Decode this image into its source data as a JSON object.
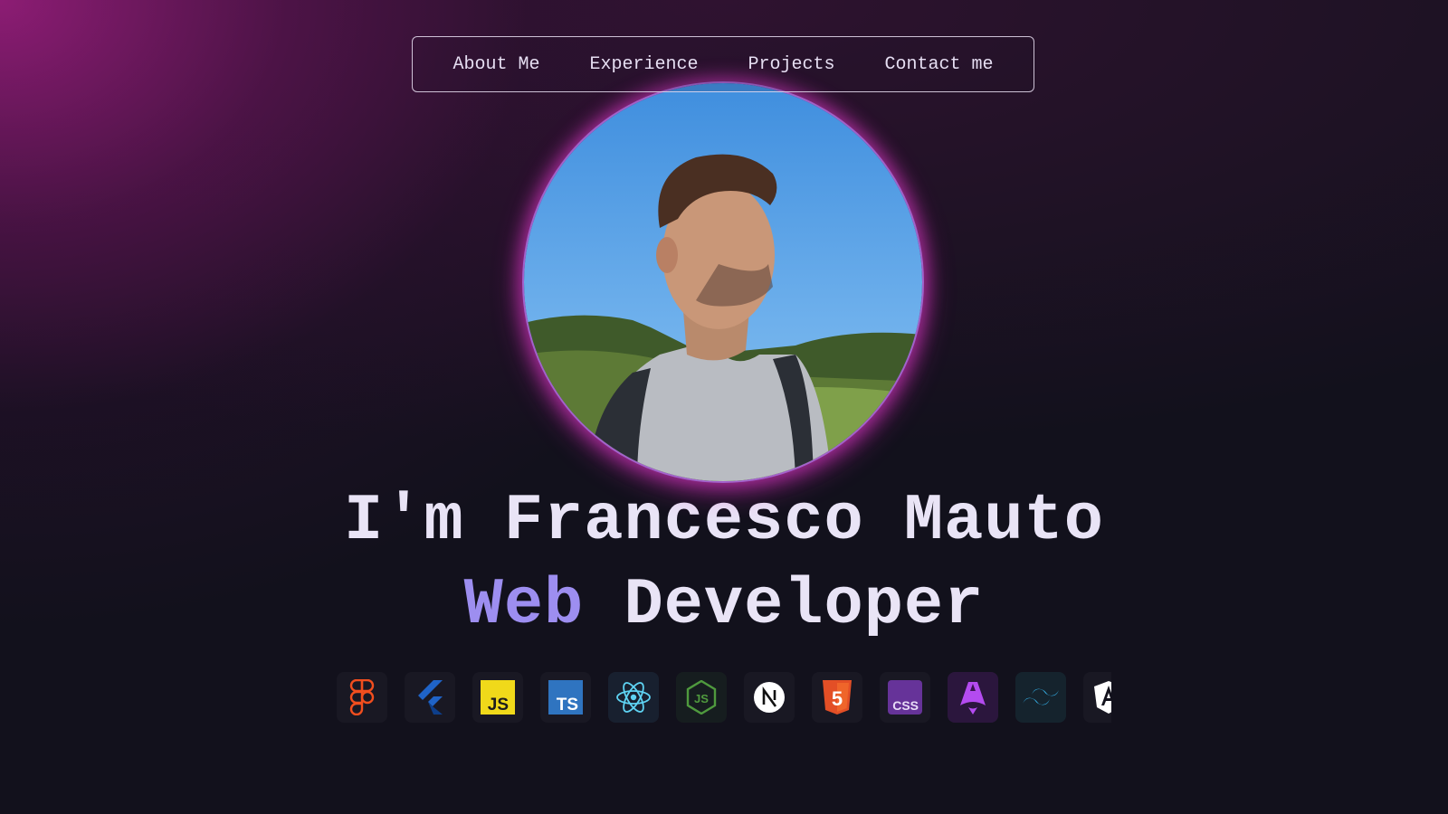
{
  "nav": {
    "items": [
      {
        "label": "About Me"
      },
      {
        "label": "Experience"
      },
      {
        "label": "Projects"
      },
      {
        "label": "Contact me"
      }
    ]
  },
  "hero": {
    "line1": "I'm Francesco Mauto",
    "role_accent": "Web",
    "role_rest": " Developer"
  },
  "tech_icons": [
    {
      "name": "figma-icon"
    },
    {
      "name": "flutter-icon"
    },
    {
      "name": "javascript-icon",
      "text": "JS"
    },
    {
      "name": "typescript-icon",
      "text": "TS"
    },
    {
      "name": "react-icon"
    },
    {
      "name": "nodejs-icon"
    },
    {
      "name": "nextjs-icon"
    },
    {
      "name": "html5-icon",
      "text": "5"
    },
    {
      "name": "css-icon",
      "text": "CSS"
    },
    {
      "name": "astro-icon"
    },
    {
      "name": "tailwind-icon"
    },
    {
      "name": "angular-icon"
    }
  ],
  "colors": {
    "background": "#12111c",
    "glow": "#a01e82",
    "accent": "#9d8ef0",
    "text": "#e9e4f6"
  }
}
